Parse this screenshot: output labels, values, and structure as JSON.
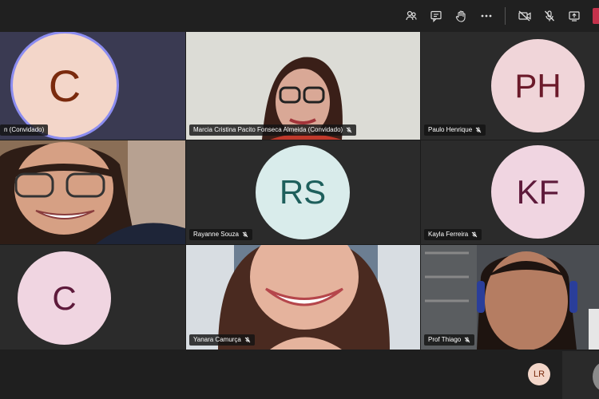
{
  "topbar": {
    "icons": [
      "participants-icon",
      "chat-icon",
      "raise-hand-icon",
      "more-icon",
      "camera-off-icon",
      "mic-off-icon",
      "share-screen-icon"
    ]
  },
  "tiles": [
    {
      "initials": "C",
      "name": "n (Convidado)",
      "avatar_bg": "#f3d6c9",
      "avatar_text": "#7a2a0d"
    },
    {
      "name": "Marcia Cristina Pacito Fonseca Almeida (Convidado)"
    },
    {
      "initials": "PH",
      "name": "Paulo Henrique",
      "avatar_bg": "#f0d5d9",
      "avatar_text": "#6b1a2a"
    },
    {
      "name": ""
    },
    {
      "initials": "RS",
      "name": "Rayanne Souza",
      "avatar_bg": "#d9eceb",
      "avatar_text": "#1e5f5c"
    },
    {
      "initials": "KF",
      "name": "Kayla Ferreira",
      "avatar_bg": "#f0d5e1",
      "avatar_text": "#5e1a3b"
    },
    {
      "initials": "C",
      "name": "",
      "avatar_bg": "#f0d5e1",
      "avatar_text": "#5e1a3b"
    },
    {
      "name": "Yanara Camurça"
    },
    {
      "name": "Prof Thiago"
    }
  ],
  "self": {
    "initials": "LR",
    "avatar_bg": "#f3d6c9",
    "avatar_text": "#7a2a0d"
  },
  "colors": {
    "accent_ring": "#8b8cf0",
    "leave": "#c4314b"
  }
}
